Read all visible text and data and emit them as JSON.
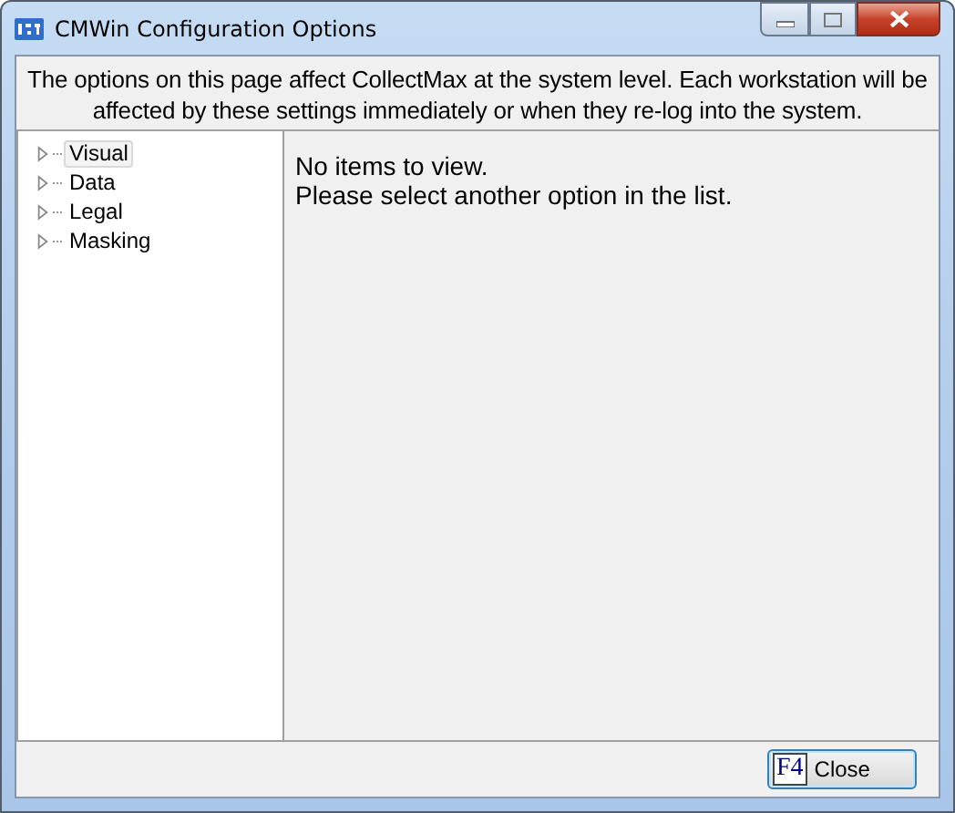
{
  "window": {
    "title": "CMWin Configuration Options"
  },
  "description": "The options on this page affect CollectMax at the system level. Each workstation will be affected by these settings immediately or when they re-log into the system.",
  "tree": {
    "items": [
      {
        "label": "Visual",
        "selected": true,
        "expanded": false
      },
      {
        "label": "Data",
        "selected": false,
        "expanded": false
      },
      {
        "label": "Legal",
        "selected": false,
        "expanded": false
      },
      {
        "label": "Masking",
        "selected": false,
        "expanded": false
      }
    ]
  },
  "detail": {
    "lines": [
      "No items to view.",
      "Please select another option in the list."
    ]
  },
  "buttons": [
    {
      "key": "F4",
      "label": "Close"
    }
  ]
}
